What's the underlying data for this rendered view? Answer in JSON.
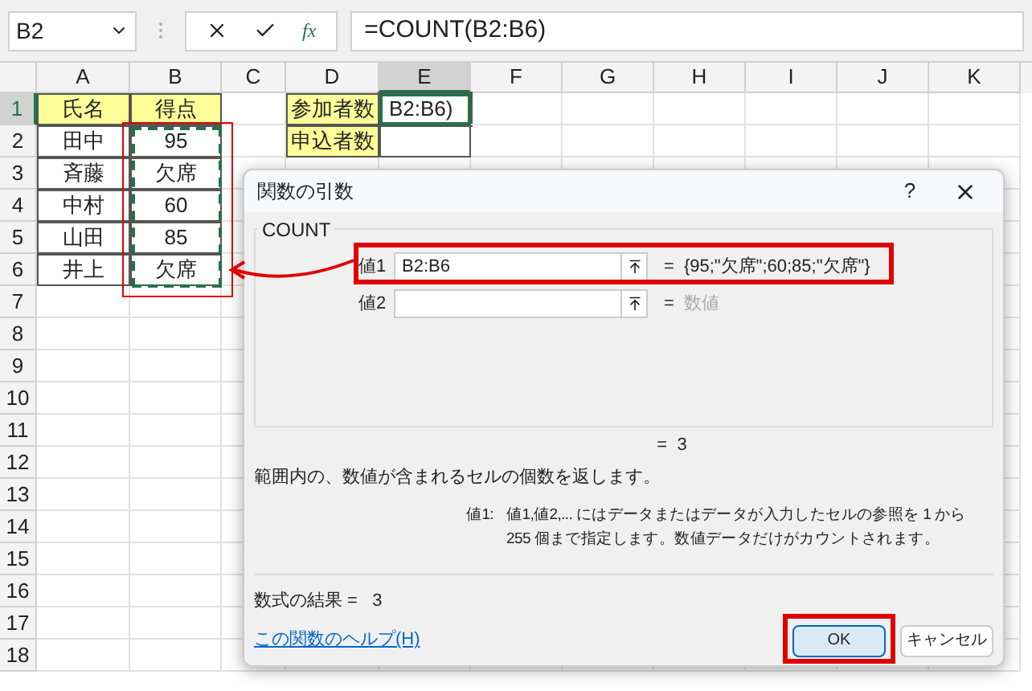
{
  "name_box": {
    "value": "B2"
  },
  "formula_bar": {
    "fx": "fx",
    "formula": "=COUNT(B2:B6)"
  },
  "columns": [
    {
      "label": "A",
      "selected": false
    },
    {
      "label": "B",
      "selected": false
    },
    {
      "label": "C",
      "selected": false
    },
    {
      "label": "D",
      "selected": false
    },
    {
      "label": "E",
      "selected": true
    },
    {
      "label": "F",
      "selected": false
    },
    {
      "label": "G",
      "selected": false
    },
    {
      "label": "H",
      "selected": false
    },
    {
      "label": "I",
      "selected": false
    },
    {
      "label": "J",
      "selected": false
    },
    {
      "label": "K",
      "selected": false
    }
  ],
  "rows": [
    {
      "label": "1",
      "selected": true,
      "cells": [
        {
          "text": "氏名",
          "highlighted": true,
          "boxed": true
        },
        {
          "text": "得点",
          "highlighted": true,
          "boxed": true
        },
        {},
        {
          "text": "参加者数",
          "highlighted": true,
          "boxed": true
        },
        {
          "text": "B2:B6)",
          "active": true,
          "boxed": true
        }
      ]
    },
    {
      "label": "2",
      "selected": false,
      "cells": [
        {
          "text": "田中",
          "boxed": true
        },
        {
          "text": "95",
          "boxed": true
        },
        {},
        {
          "text": "申込者数",
          "highlighted": true,
          "boxed": true
        },
        {
          "boxed": true
        }
      ]
    },
    {
      "label": "3",
      "selected": false,
      "cells": [
        {
          "text": "斉藤",
          "boxed": true
        },
        {
          "text": "欠席",
          "boxed": true
        }
      ]
    },
    {
      "label": "4",
      "selected": false,
      "cells": [
        {
          "text": "中村",
          "boxed": true
        },
        {
          "text": "60",
          "boxed": true
        }
      ]
    },
    {
      "label": "5",
      "selected": false,
      "cells": [
        {
          "text": "山田",
          "boxed": true
        },
        {
          "text": "85",
          "boxed": true
        }
      ]
    },
    {
      "label": "6",
      "selected": false,
      "cells": [
        {
          "text": "井上",
          "boxed": true
        },
        {
          "text": "欠席",
          "boxed": true
        }
      ]
    },
    {
      "label": "7",
      "selected": false
    },
    {
      "label": "8",
      "selected": false
    },
    {
      "label": "9",
      "selected": false
    },
    {
      "label": "10",
      "selected": false
    },
    {
      "label": "11",
      "selected": false
    },
    {
      "label": "12",
      "selected": false
    },
    {
      "label": "13",
      "selected": false
    },
    {
      "label": "14",
      "selected": false
    },
    {
      "label": "15",
      "selected": false
    },
    {
      "label": "16",
      "selected": false
    },
    {
      "label": "17",
      "selected": false
    },
    {
      "label": "18",
      "selected": false
    }
  ],
  "dialog": {
    "title": "関数の引数",
    "help": "?",
    "function_name": "COUNT",
    "arguments": [
      {
        "label": "値1",
        "value": "B2:B6",
        "equals": "=",
        "result": "{95;\"欠席\";60;85;\"欠席\"}"
      },
      {
        "label": "値2",
        "equals": "=",
        "result_placeholder": "数値"
      }
    ],
    "total": "=  3",
    "description": "範囲内の、数値が含まれるセルの個数を返します。",
    "argument_help_label": "値1:",
    "argument_help": "値1,値2,... にはデータまたはデータが入力したセルの参照を 1 から 255 個まで指定します。数値データだけがカウントされます。",
    "formula_result": "数式の結果 =   3",
    "help_link": "この関数のヘルプ(H)",
    "buttons": [
      {
        "label": "OK",
        "selected": true
      },
      {
        "label": "キャンセル",
        "selected": false
      }
    ]
  }
}
